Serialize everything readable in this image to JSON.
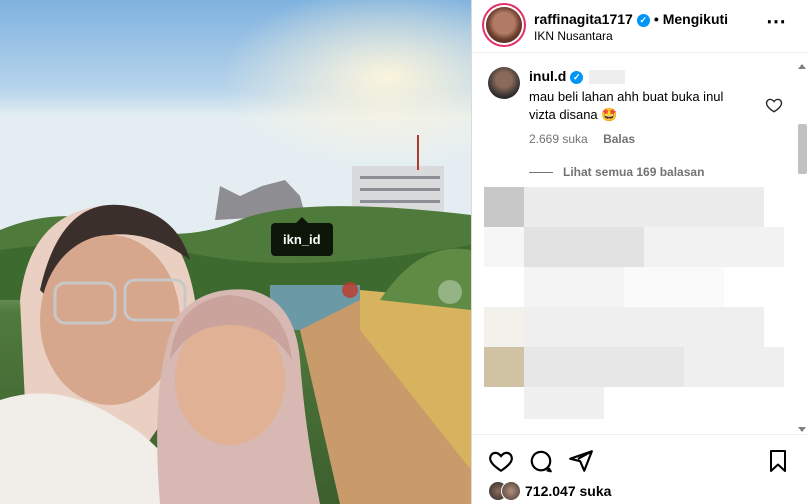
{
  "post": {
    "tag_label": "ikn_id",
    "header": {
      "username": "raffinagita1717",
      "follow_label": "Mengikuti",
      "location": "IKN Nusantara"
    },
    "comment": {
      "username": "inul.d",
      "text": "mau beli lahan ahh buat buka inul vizta disana 🤩",
      "likes": "2.669 suka",
      "reply_label": "Balas"
    },
    "view_replies": "Lihat semua 169 balasan",
    "likes_count": "712.047 suka"
  },
  "icons": {
    "verified": "verified-badge",
    "more": "more-icon",
    "heart": "heart-icon",
    "comment": "comment-icon",
    "share": "share-icon",
    "save": "bookmark-icon"
  },
  "colors": {
    "verified": "#0095f6",
    "muted_text": "#737373"
  }
}
